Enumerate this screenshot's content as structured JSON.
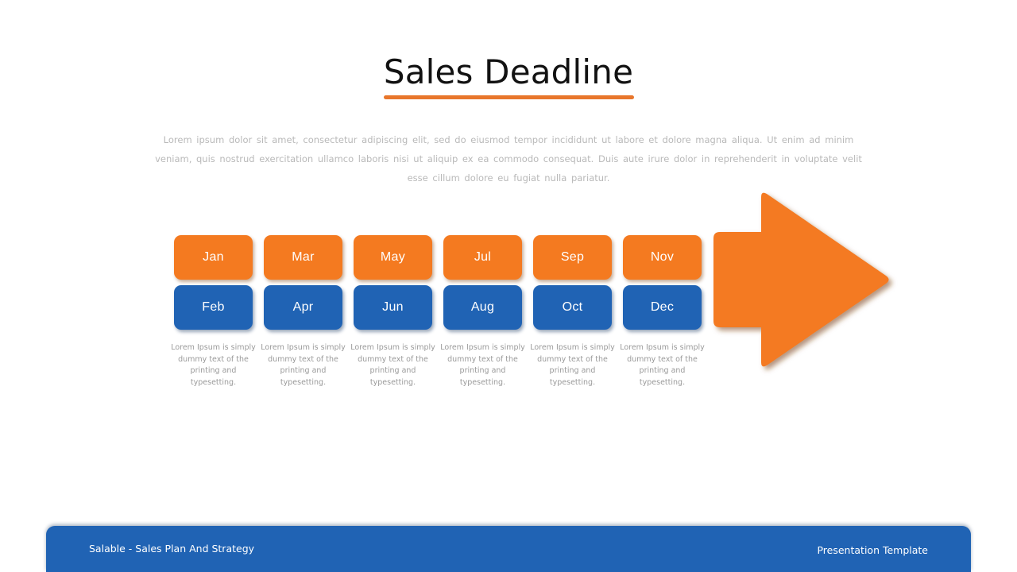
{
  "slide": {
    "title": "Sales Deadline",
    "intro": "Lorem ipsum dolor sit amet, consectetur adipiscing elit, sed do eiusmod tempor incididunt ut labore et dolore magna aliqua. Ut enim ad minim veniam, quis nostrud exercitation ullamco laboris nisi ut aliquip ex ea commodo consequat. Duis aute irure dolor in reprehenderit in voluptate velit esse cillum dolore eu fugiat nulla pariatur.",
    "colors": {
      "orange": "#F47A20",
      "orange_rule": "#E8762B",
      "blue": "#2063B4",
      "title_text": "#121212",
      "body_text": "#b9b9b9",
      "caption_text": "#9a9a9a",
      "background": "#ffffff"
    }
  },
  "timeline": {
    "caption_text": "Lorem Ipsum is simply dummy text of the printing and typesetting.",
    "columns": [
      {
        "top_label": "Jan",
        "bottom_label": "Feb",
        "caption": "Lorem Ipsum is simply dummy text of the printing and typesetting."
      },
      {
        "top_label": "Mar",
        "bottom_label": "Apr",
        "caption": "Lorem Ipsum is simply dummy text of the printing and typesetting."
      },
      {
        "top_label": "May",
        "bottom_label": "Jun",
        "caption": "Lorem Ipsum is simply dummy text of the printing and typesetting."
      },
      {
        "top_label": "Jul",
        "bottom_label": "Aug",
        "caption": "Lorem Ipsum is simply dummy text of the printing and typesetting."
      },
      {
        "top_label": "Sep",
        "bottom_label": "Oct",
        "caption": "Lorem Ipsum is simply dummy text of the printing and typesetting."
      },
      {
        "top_label": "Nov",
        "bottom_label": "Dec",
        "caption": "Lorem Ipsum is simply dummy text of the printing and typesetting."
      }
    ]
  },
  "arrow": {
    "icon": "right-arrow-icon",
    "direction": "right",
    "color": "#F47A20"
  },
  "footer": {
    "left_label": "Salable - Sales Plan And Strategy",
    "right_label": "Presentation Template"
  }
}
